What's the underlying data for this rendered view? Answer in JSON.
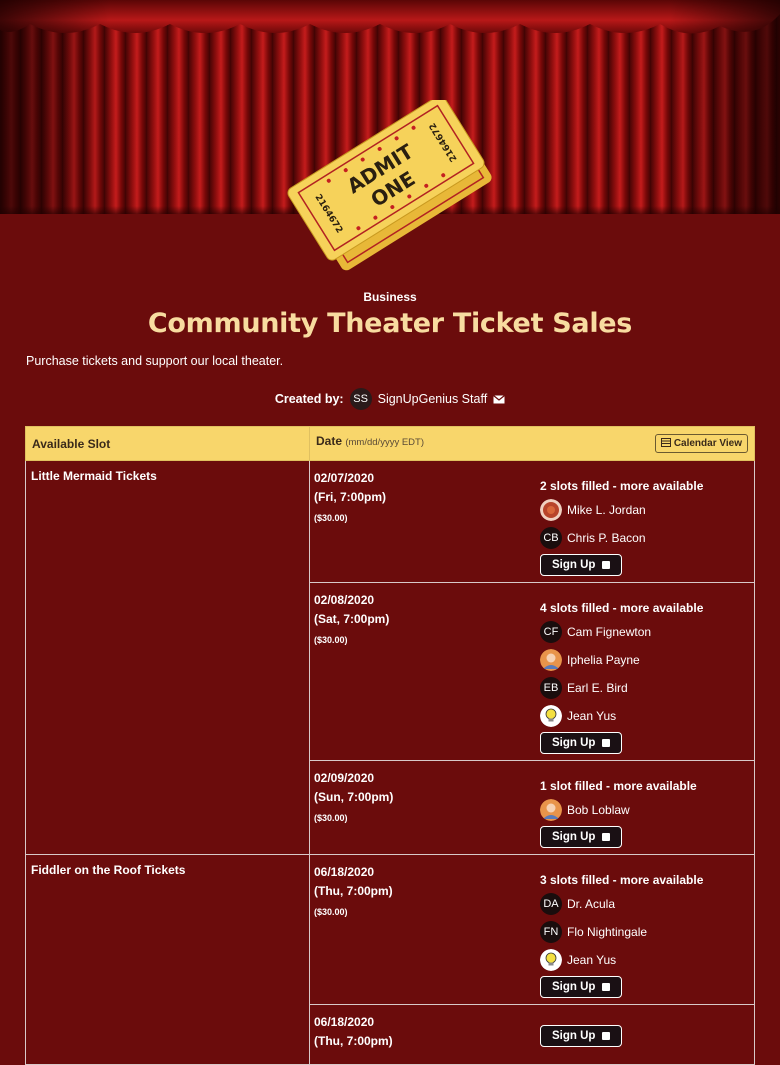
{
  "banner": {
    "ticket_text_top": "ADMIT",
    "ticket_text_bottom": "ONE",
    "ticket_serial": "2164672",
    "ticket_serial_back": "2164"
  },
  "category": "Business",
  "title": "Community Theater Ticket Sales",
  "description": "Purchase tickets and support our local theater.",
  "creator": {
    "label": "Created by:",
    "initials": "SS",
    "name": "SignUpGenius Staff",
    "icon": "envelope-icon"
  },
  "table": {
    "col_slot": "Available Slot",
    "col_date": "Date",
    "date_format": "(mm/dd/yyyy EDT)",
    "calendar_button": "Calendar View",
    "signup_label": "Sign Up",
    "groups": [
      {
        "name": "Little Mermaid Tickets",
        "rows": [
          {
            "date": "02/07/2020",
            "time": "(Fri, 7:00pm)",
            "price": "($30.00)",
            "status": "2 slots filled - more available",
            "people": [
              {
                "initials": "",
                "name": "Mike L. Jordan",
                "photo": "red"
              },
              {
                "initials": "CB",
                "name": "Chris P. Bacon"
              }
            ]
          },
          {
            "date": "02/08/2020",
            "time": "(Sat, 7:00pm)",
            "price": "($30.00)",
            "status": "4 slots filled - more available",
            "people": [
              {
                "initials": "CF",
                "name": "Cam Fignewton"
              },
              {
                "initials": "",
                "name": "Iphelia Payne",
                "photo": "orange"
              },
              {
                "initials": "EB",
                "name": "Earl E. Bird"
              },
              {
                "initials": "",
                "name": "Jean Yus",
                "photo": "bulb"
              }
            ]
          },
          {
            "date": "02/09/2020",
            "time": "(Sun, 7:00pm)",
            "price": "($30.00)",
            "status": "1 slot filled - more available",
            "people": [
              {
                "initials": "",
                "name": "Bob Loblaw",
                "photo": "orange"
              }
            ]
          }
        ]
      },
      {
        "name": "Fiddler on the Roof Tickets",
        "rows": [
          {
            "date": "06/18/2020",
            "time": "(Thu, 7:00pm)",
            "price": "($30.00)",
            "status": "3 slots filled - more available",
            "people": [
              {
                "initials": "DA",
                "name": "Dr. Acula"
              },
              {
                "initials": "FN",
                "name": "Flo Nightingale"
              },
              {
                "initials": "",
                "name": "Jean Yus",
                "photo": "bulb"
              }
            ]
          },
          {
            "date": "06/18/2020",
            "time": "(Thu, 7:00pm)",
            "price": "",
            "status": "",
            "people": []
          }
        ]
      }
    ]
  }
}
